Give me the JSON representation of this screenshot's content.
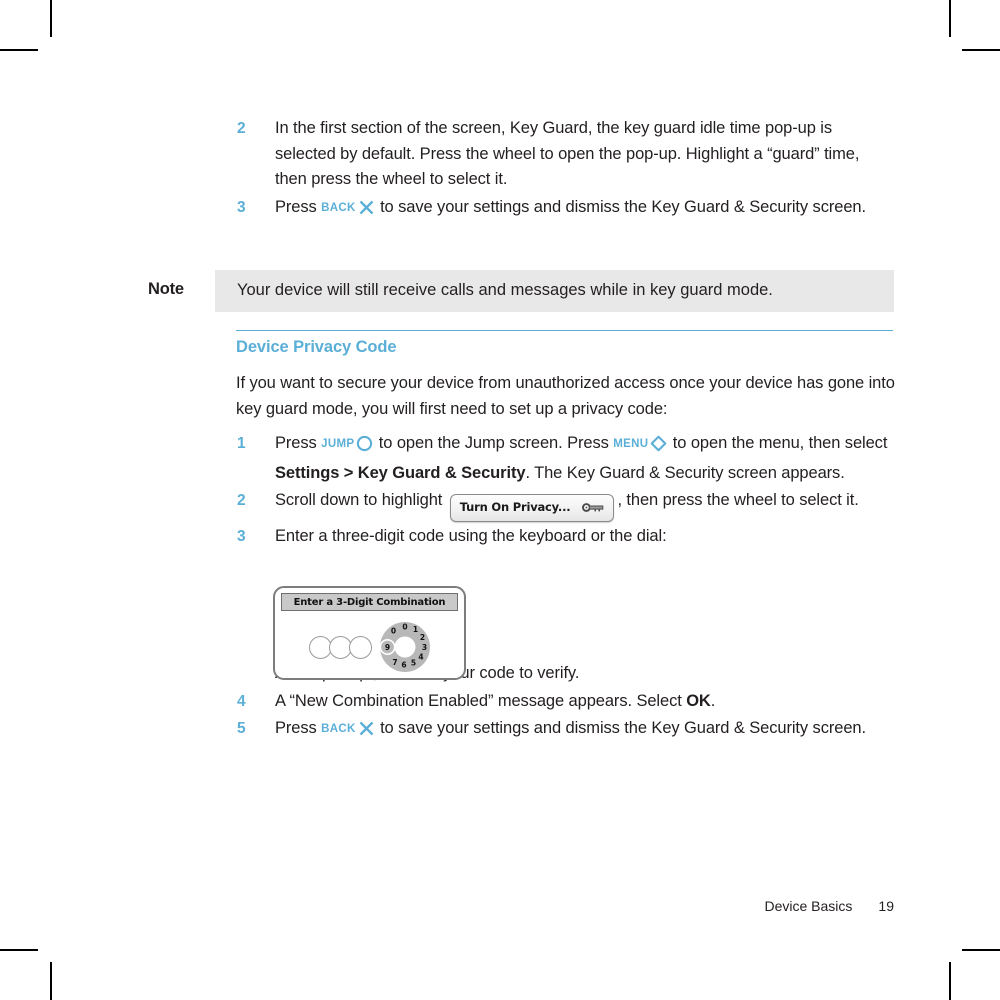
{
  "document": {
    "section_heading": "Device Privacy Code",
    "intro_paragraph": "If you want to secure your device from unauthorized access once your device has gone into key guard mode, you will first need to set up a privacy code:"
  },
  "steps_top": [
    {
      "number": "2",
      "text": "In the first section of the screen, Key Guard, the key guard idle time pop-up is selected by default. Press the wheel to open the pop-up. Highlight a “guard” time, then press the wheel to select it."
    },
    {
      "number": "3",
      "text_before": "Press ",
      "key_label": "BACK",
      "key_icon": "x-icon",
      "text_after": " to save your settings and dismiss the Key Guard & Security screen."
    }
  ],
  "note": {
    "label": "Note",
    "text": "Your device will still receive calls and messages while in key guard mode."
  },
  "steps_bottom": [
    {
      "number": "1",
      "part1": "Press ",
      "key1_label": "JUMP",
      "key1_icon": "circle-icon",
      "part2": " to open the Jump screen. Press ",
      "key2_label": "MENU",
      "key2_icon": "diamond-icon",
      "part3": " to open the menu, then select ",
      "bold_text": "Settings > Key Guard & Security",
      "part4": ". The Key Guard & Security screen appears."
    },
    {
      "number": "2",
      "part1": "Scroll down to highlight ",
      "chip_label": "Turn On Privacy...",
      "chip_icon": "key-icon",
      "part2": ", then press the wheel to select it."
    },
    {
      "number": "3",
      "text": "Enter a three-digit code using the keyboard or the dial:"
    },
    {
      "number": "",
      "text": "At the prompt, re-enter your code to verify."
    },
    {
      "number": "4",
      "part1": "A “New Combination Enabled” message appears. Select ",
      "bold_text": "OK",
      "part2": "."
    },
    {
      "number": "5",
      "part1": "Press ",
      "key_label": "BACK",
      "key_icon": "x-icon",
      "part2": " to save your settings and dismiss the Key Guard & Security screen."
    }
  ],
  "device_figure": {
    "title": "Enter a 3-Digit Combination",
    "slots": [
      "",
      "",
      ""
    ],
    "dial_digits": [
      "0",
      "1",
      "2",
      "3",
      "4",
      "5",
      "6",
      "7",
      "8",
      "9"
    ],
    "dial_highlighted": "9"
  },
  "footer": {
    "section": "Device Basics",
    "page_number": "19"
  },
  "colors": {
    "accent": "#5BAFD7",
    "note_background": "#e8e8e8",
    "text": "#231f20"
  }
}
